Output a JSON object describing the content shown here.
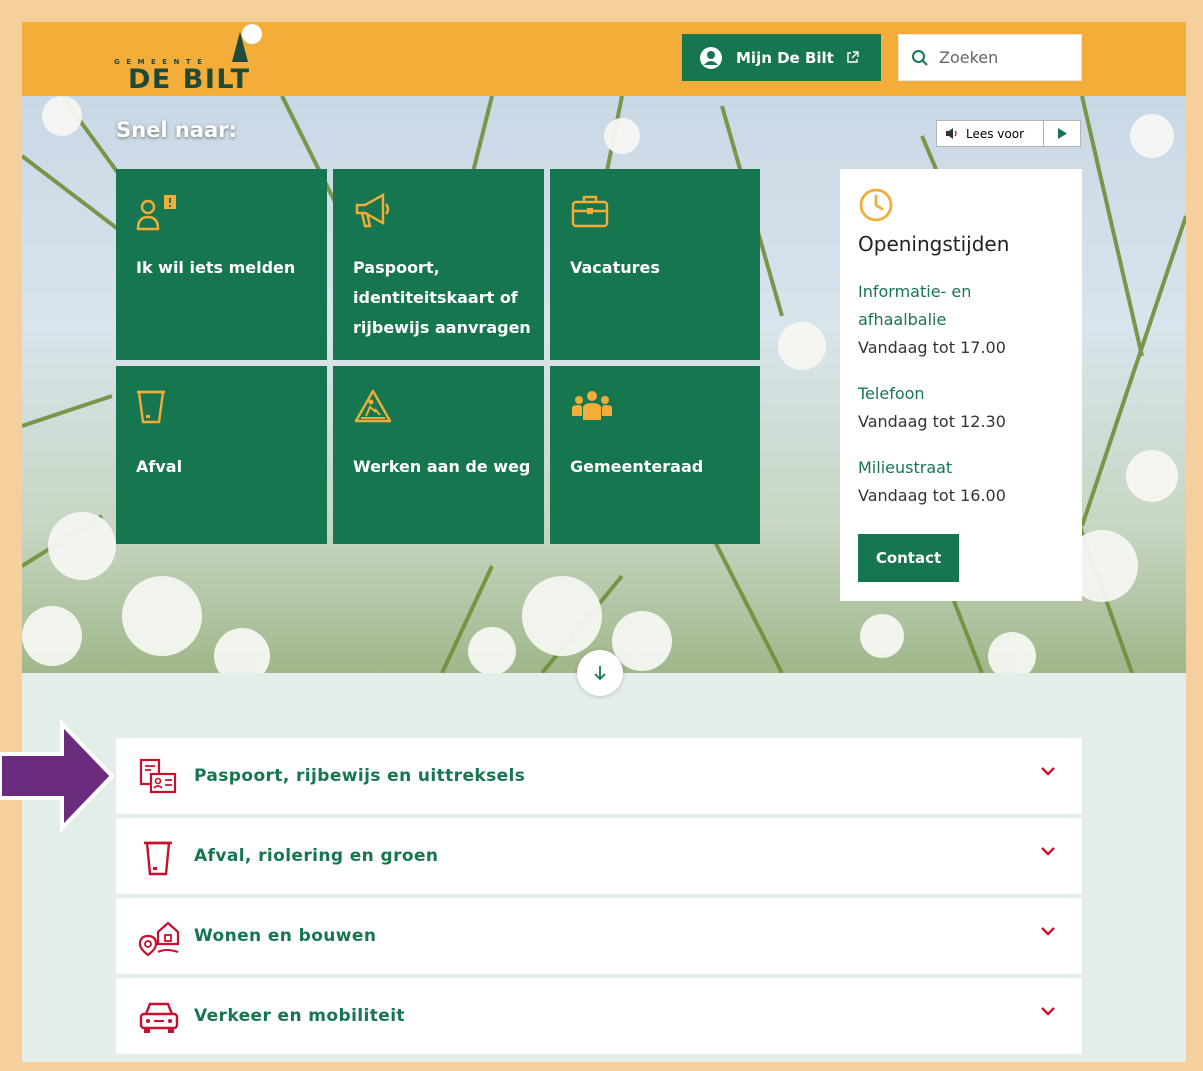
{
  "header": {
    "logo_small": "GEMEENTE",
    "logo_big": "DE BILT",
    "mijn_label": "Mijn De Bilt",
    "search_placeholder": "Zoeken"
  },
  "hero": {
    "snel_label": "Snel naar:",
    "lees_voor_label": "Lees voor",
    "tiles": [
      {
        "label": "Ik wil iets melden",
        "icon": "report-person-icon"
      },
      {
        "label": "Paspoort, identiteitskaart of rijbewijs aanvragen",
        "icon": "megaphone-icon"
      },
      {
        "label": "Vacatures",
        "icon": "briefcase-icon"
      },
      {
        "label": "Afval",
        "icon": "bin-icon"
      },
      {
        "label": "Werken aan de weg",
        "icon": "roadwork-icon"
      },
      {
        "label": "Gemeenteraad",
        "icon": "council-icon"
      }
    ]
  },
  "hours": {
    "title": "Openingstijden",
    "items": [
      {
        "name": "Informatie- en afhaalbalie",
        "time": "Vandaag tot 17.00"
      },
      {
        "name": "Telefoon",
        "time": "Vandaag tot 12.30"
      },
      {
        "name": "Milieustraat",
        "time": "Vandaag tot 16.00"
      }
    ],
    "contact_label": "Contact"
  },
  "accordion": [
    {
      "label": "Paspoort, rijbewijs en uittreksels",
      "icon": "id-documents-icon"
    },
    {
      "label": "Afval, riolering en groen",
      "icon": "bin-icon"
    },
    {
      "label": "Wonen en bouwen",
      "icon": "house-location-icon"
    },
    {
      "label": "Verkeer en mobiliteit",
      "icon": "car-icon"
    }
  ],
  "colors": {
    "brand_green": "#16764f",
    "header_orange": "#f3ad38",
    "icon_yellow": "#f3ad38",
    "accent_red": "#c8102e",
    "annotation_arrow": "#6b2c7e"
  }
}
